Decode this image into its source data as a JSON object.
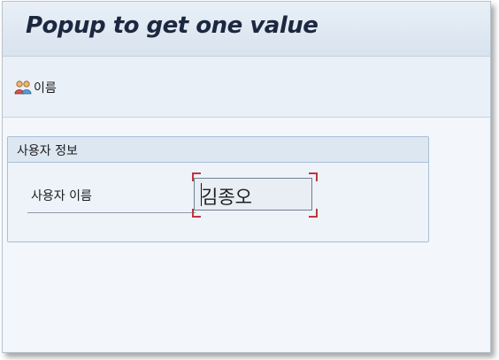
{
  "window": {
    "title": "Popup to get one value"
  },
  "toolbar": {
    "button_label": "이름",
    "button_icon": "two-users-icon"
  },
  "group": {
    "title": "사용자 정보",
    "field": {
      "label": "사용자 이름",
      "value": "김종오"
    }
  },
  "colors": {
    "focus_corner": "#c0353d",
    "title_text": "#1c2740"
  }
}
